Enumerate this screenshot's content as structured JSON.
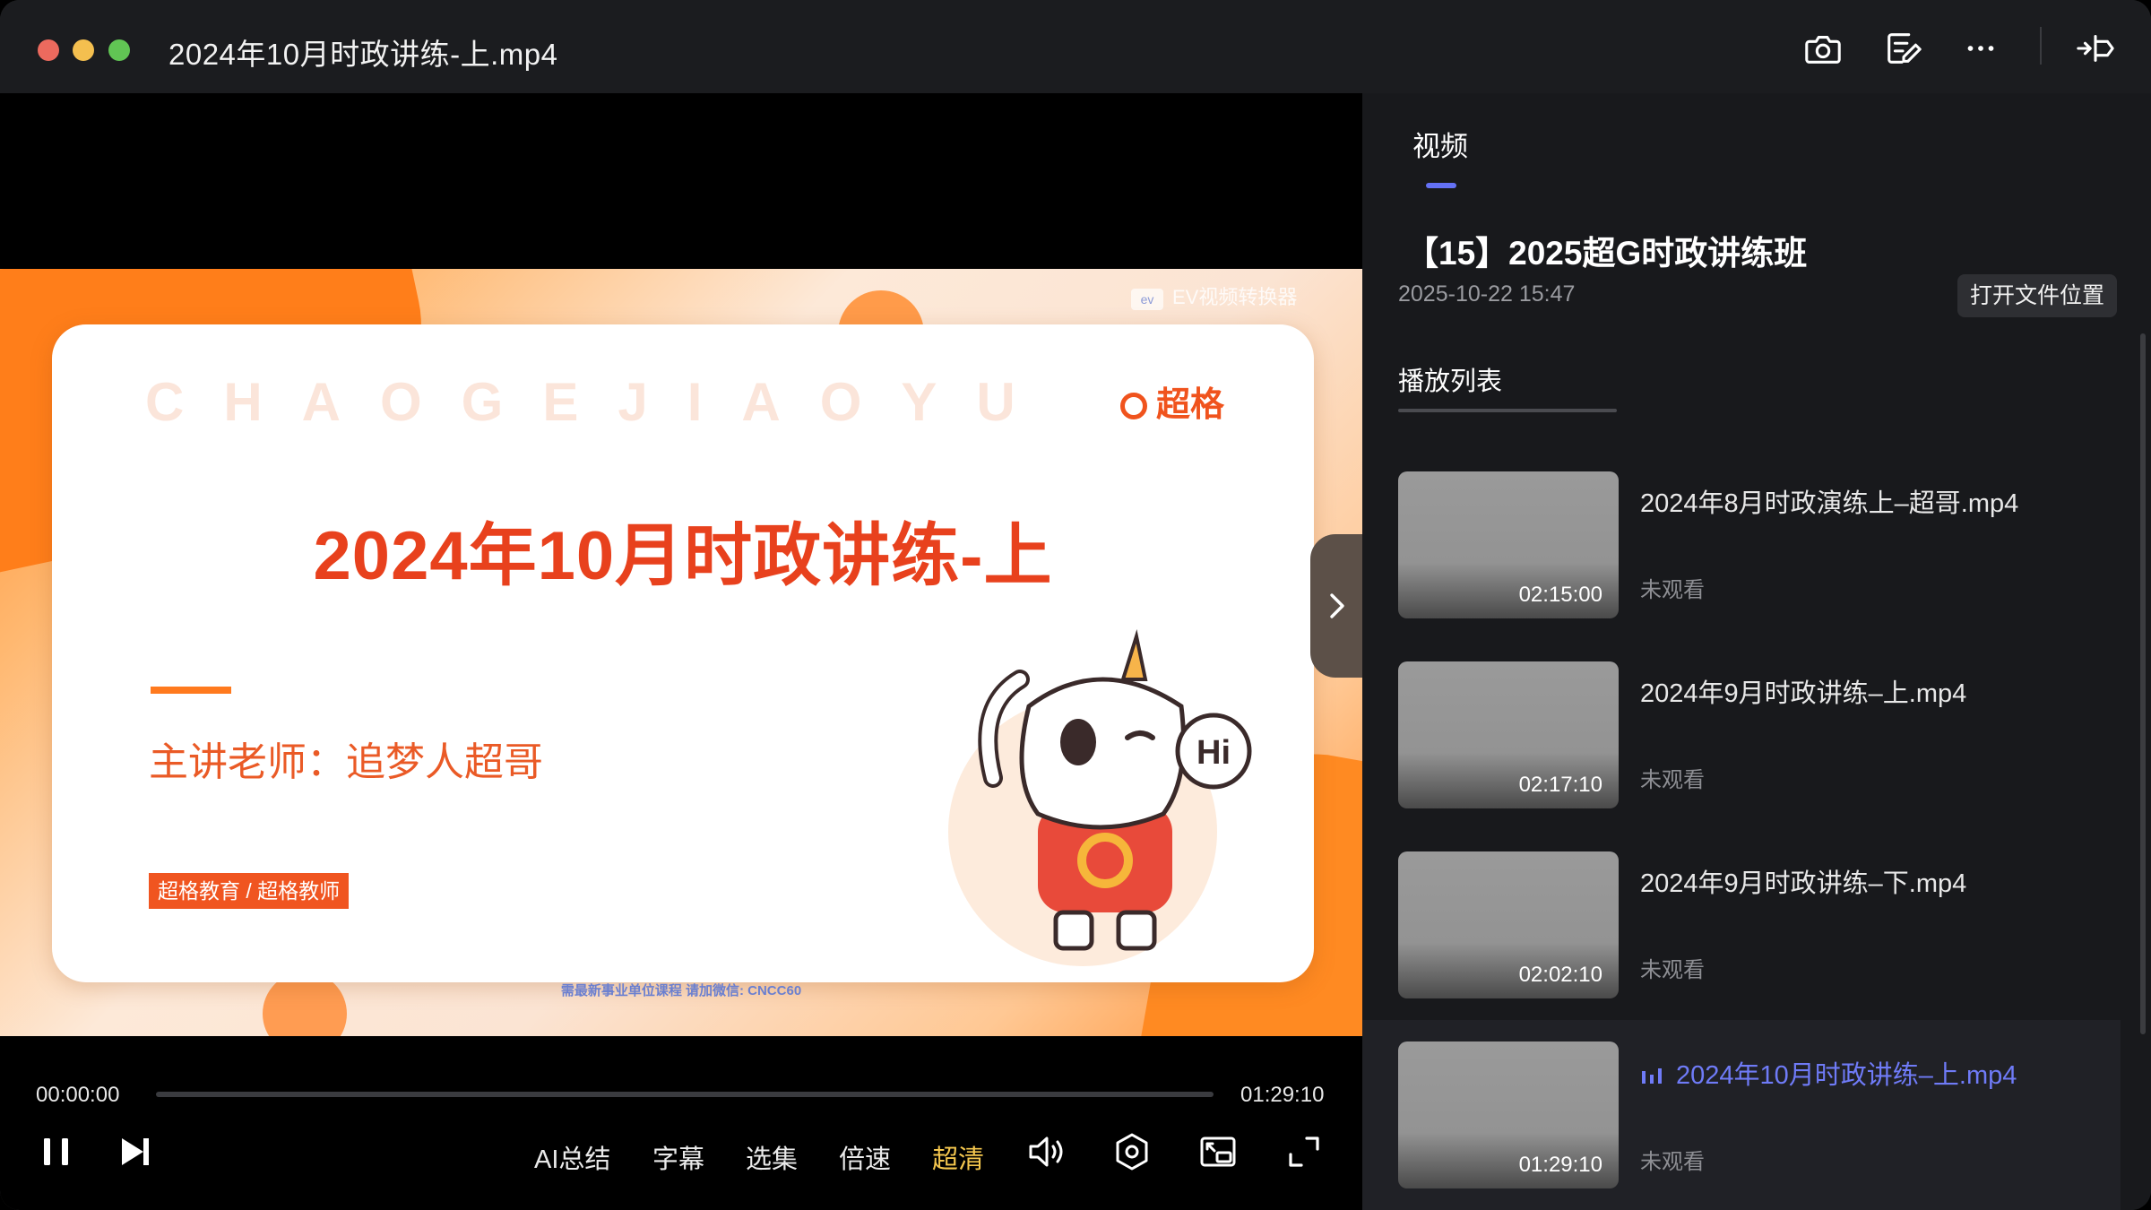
{
  "window": {
    "title": "2024年10月时政讲练-上.mp4"
  },
  "toolbar": {
    "icons": [
      "camera-icon",
      "edit-note-icon",
      "more-icon",
      "pin-window-icon"
    ]
  },
  "video": {
    "watermark": "EV视频转换器",
    "watermark_badge": "ev",
    "slide": {
      "letters": "CHAOGEJIAOYU",
      "brand": "超格",
      "title": "2024年10月时政讲练-上",
      "teacher": "主讲老师：追梦人超哥",
      "social": "超格教育 / 超格教师",
      "footnote": "需最新事业单位课程 请加微信: CNCC60",
      "mascot_text": "Hi"
    }
  },
  "player": {
    "current_time": "00:00:00",
    "total_time": "01:29:10",
    "progress": 0,
    "buttons": {
      "ai_summary": "AI总结",
      "subtitle": "字幕",
      "episodes": "选集",
      "speed": "倍速",
      "quality": "超清"
    },
    "colors": {
      "active": "#f5c74e"
    }
  },
  "sidebar": {
    "tab": "视频",
    "course_title": "【15】2025超G时政讲练班",
    "date": "2025-10-22 15:47",
    "open_folder": "打开文件位置",
    "playlist_label": "播放列表",
    "accent": "#6f7bf7",
    "items": [
      {
        "title": "2024年8月时政演练上–超哥.mp4",
        "duration": "02:15:00",
        "status": "未观看",
        "active": false
      },
      {
        "title": "2024年9月时政讲练–上.mp4",
        "duration": "02:17:10",
        "status": "未观看",
        "active": false
      },
      {
        "title": "2024年9月时政讲练–下.mp4",
        "duration": "02:02:10",
        "status": "未观看",
        "active": false
      },
      {
        "title": "2024年10月时政讲练–上.mp4",
        "duration": "01:29:10",
        "status": "未观看",
        "active": true
      }
    ]
  }
}
